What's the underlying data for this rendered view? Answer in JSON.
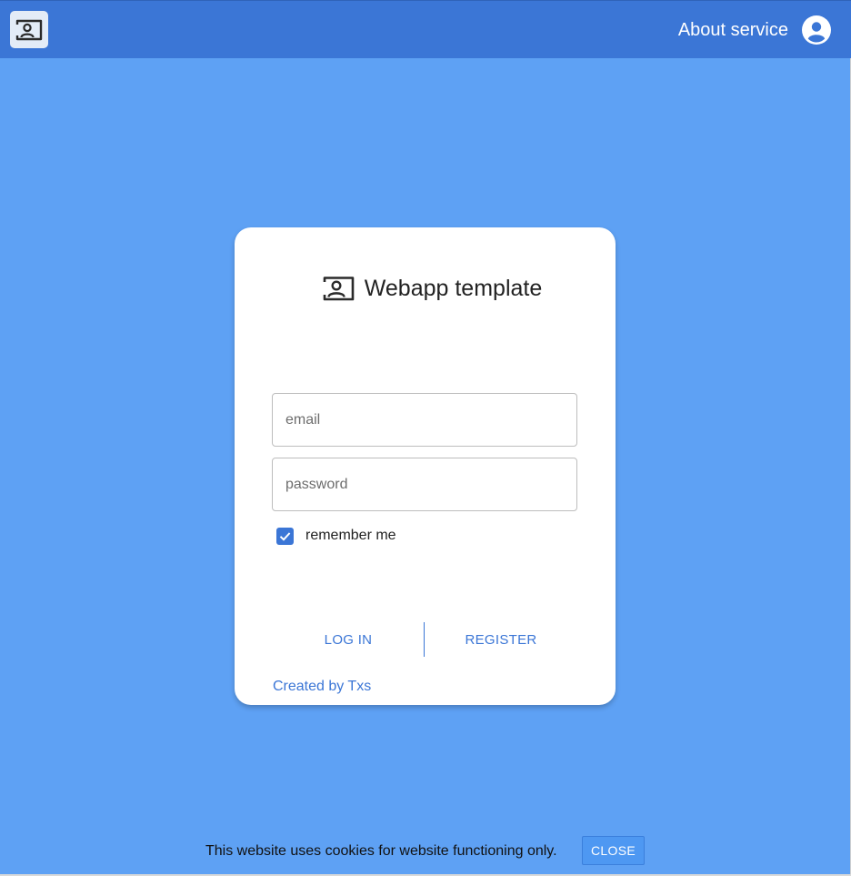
{
  "header": {
    "about_label": "About service",
    "logo_icon": "account-box-outline-icon",
    "account_icon": "account-circle-icon",
    "bar_color": "#3b76d6"
  },
  "card": {
    "brand_icon": "account-box-outline-icon",
    "title": "Webapp template",
    "email_placeholder": "email",
    "email_value": "",
    "password_placeholder": "password",
    "password_value": "",
    "remember_label": "remember me",
    "remember_checked": true,
    "login_label": "LOG IN",
    "register_label": "REGISTER",
    "credit_label": "Created by Txs"
  },
  "cookie": {
    "message": "This website uses cookies for website functioning only.",
    "close_label": "CLOSE"
  },
  "colors": {
    "background": "#5ea1f4",
    "accent": "#3b76d6",
    "card": "#ffffff"
  }
}
